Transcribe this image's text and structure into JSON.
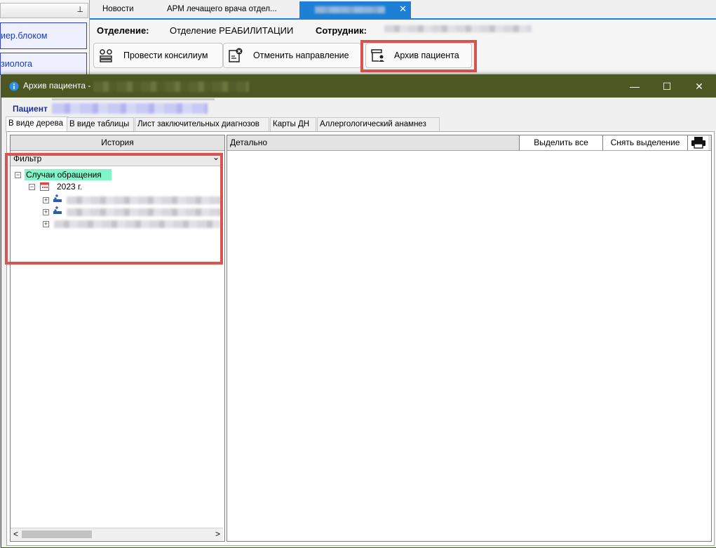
{
  "left_panel": {
    "pin_icon": "pin-icon",
    "items": [
      {
        "label": "иер.блоком"
      },
      {
        "label": "зиолога"
      }
    ]
  },
  "top_tabs": [
    {
      "label": "Новости"
    },
    {
      "label": "АРМ лечащего врача отдел..."
    },
    {
      "label": ""
    }
  ],
  "header": {
    "department_label": "Отделение:",
    "department_value": "Отделение РЕАБИЛИТАЦИИ",
    "employee_label": "Сотрудник:"
  },
  "toolbar": {
    "consilium_label": "Провести консилиум",
    "cancel_referral_label": "Отменить направление",
    "archive_label": "Архив пациента"
  },
  "modal": {
    "title": "Архив пациента -",
    "patient_label": "Пациент",
    "tabs": [
      {
        "label": "В виде дерева"
      },
      {
        "label": "В виде таблицы"
      },
      {
        "label": "Лист заключительных диагнозов"
      },
      {
        "label": "Карты ДН"
      },
      {
        "label": "Аллергологический анамнез"
      }
    ],
    "history_header": "История",
    "filter_label": "Фильтр",
    "tree": {
      "root": "Случаи обращения",
      "year": "2023 г."
    },
    "detail_header": "Детально",
    "select_all_label": "Выделить все",
    "deselect_label": "Снять выделение"
  },
  "colors": {
    "titlebar": "#4d5724",
    "highlight": "#d9534f",
    "tree_root_bg": "#7ff5c8",
    "active_tab": "#1e7fd6"
  }
}
